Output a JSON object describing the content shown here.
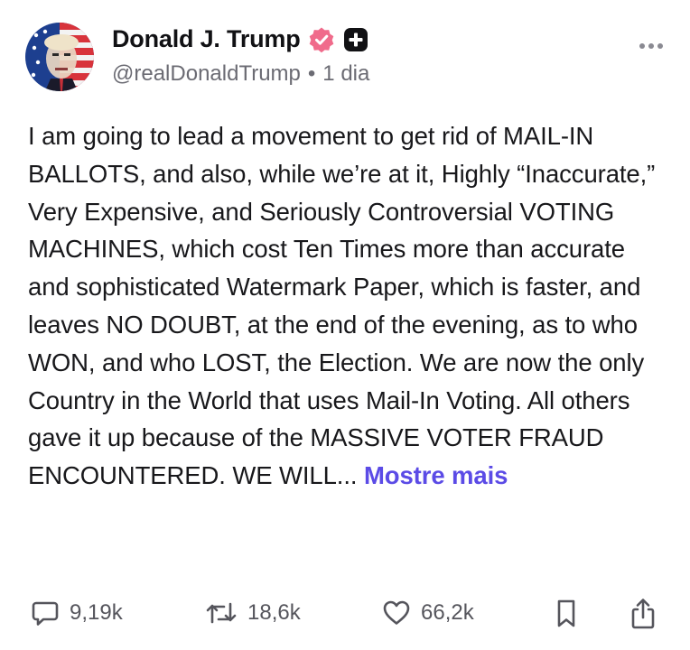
{
  "author": {
    "display_name": "Donald J. Trump",
    "handle": "@realDonaldTrump",
    "separator": "•",
    "time": "1 dia"
  },
  "post": {
    "text": "I am going to lead a movement to get rid of MAIL-IN BALLOTS, and also, while we’re at it, Highly “Inaccurate,” Very Expensive, and Seriously Controversial VOTING MACHINES, which cost Ten Times more than accurate and sophisticated Watermark Paper, which is faster, and leaves NO DOUBT, at the end of the evening, as to who WON, and who LOST, the Election. We are now the only Country in the World that uses Mail-In Voting. All others gave it up because of the MASSIVE VOTER FRAUD ENCOUNTERED. WE WILL...",
    "show_more_label": "Mostre mais"
  },
  "actions": {
    "replies": "9,19k",
    "reposts": "18,6k",
    "likes": "66,2k"
  },
  "icons": {
    "verified": "verified-badge-icon",
    "plus": "plus-badge-icon",
    "more": "more-options-icon",
    "reply": "reply-icon",
    "repost": "repost-icon",
    "like": "heart-icon",
    "bookmark": "bookmark-icon",
    "share": "share-icon"
  },
  "colors": {
    "accent": "#5b4be6",
    "verified": "#f06b8b",
    "text": "#18181b",
    "muted": "#6b6b73"
  }
}
